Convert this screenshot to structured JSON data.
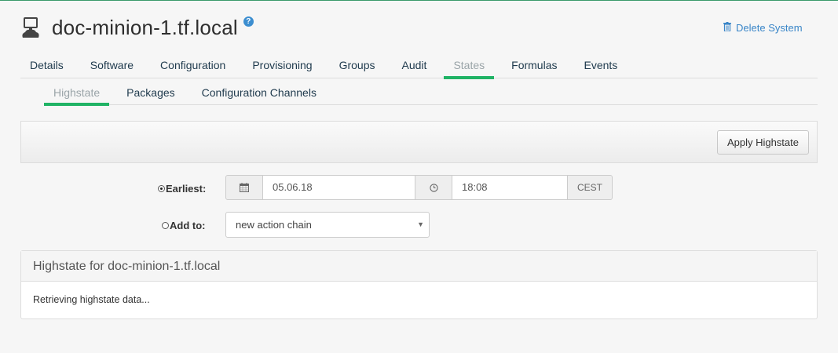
{
  "header": {
    "system_icon": "system-server-icon",
    "title": "doc-minion-1.tf.local",
    "help_icon": "question-circle-icon",
    "delete_label": "Delete System",
    "delete_icon": "trash-icon"
  },
  "tabs": [
    {
      "label": "Details"
    },
    {
      "label": "Software"
    },
    {
      "label": "Configuration"
    },
    {
      "label": "Provisioning"
    },
    {
      "label": "Groups"
    },
    {
      "label": "Audit"
    },
    {
      "label": "States",
      "active": true
    },
    {
      "label": "Formulas"
    },
    {
      "label": "Events"
    }
  ],
  "subtabs": [
    {
      "label": "Highstate",
      "active": true
    },
    {
      "label": "Packages"
    },
    {
      "label": "Configuration Channels"
    }
  ],
  "toolbar": {
    "apply_label": "Apply Highstate"
  },
  "schedule": {
    "earliest_label": "Earliest:",
    "calendar_icon": "calendar-icon",
    "date_value": "05.06.18",
    "clock_icon": "clock-icon",
    "time_value": "18:08",
    "timezone": "CEST",
    "add_to_label": "Add to:",
    "action_chain_value": "new action chain"
  },
  "panel": {
    "title": "Highstate for doc-minion-1.tf.local",
    "body": "Retrieving highstate data..."
  },
  "colors": {
    "accent": "#20b365",
    "link": "#3a86c8",
    "tab_text": "#1f3a4d"
  }
}
